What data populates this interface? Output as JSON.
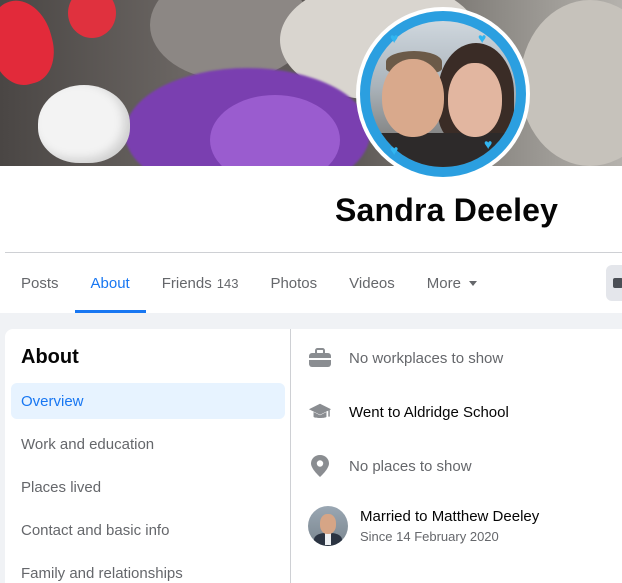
{
  "profile": {
    "name": "Sandra Deeley"
  },
  "tabs": [
    {
      "label": "Posts",
      "active": false
    },
    {
      "label": "About",
      "active": true
    },
    {
      "label": "Friends",
      "count": "143",
      "active": false
    },
    {
      "label": "Photos",
      "active": false
    },
    {
      "label": "Videos",
      "active": false
    },
    {
      "label": "More",
      "active": false,
      "icon": "caret-down-icon"
    }
  ],
  "about": {
    "title": "About",
    "nav": [
      {
        "label": "Overview",
        "active": true
      },
      {
        "label": "Work and education",
        "active": false
      },
      {
        "label": "Places lived",
        "active": false
      },
      {
        "label": "Contact and basic info",
        "active": false
      },
      {
        "label": "Family and relationships",
        "active": false
      }
    ],
    "overview": {
      "work": {
        "text": "No workplaces to show",
        "icon": "briefcase-icon"
      },
      "education": {
        "text": "Went to Aldridge School",
        "icon": "graduation-cap-icon"
      },
      "places": {
        "text": "No places to show",
        "icon": "location-pin-icon"
      },
      "relationship": {
        "text": "Married to Matthew Deeley",
        "since": "Since 14 February 2020"
      }
    }
  },
  "colors": {
    "accent": "#1877f2",
    "muted_text": "#65676b",
    "active_nav_bg": "#e7f3ff",
    "page_bg": "#f0f2f5"
  }
}
